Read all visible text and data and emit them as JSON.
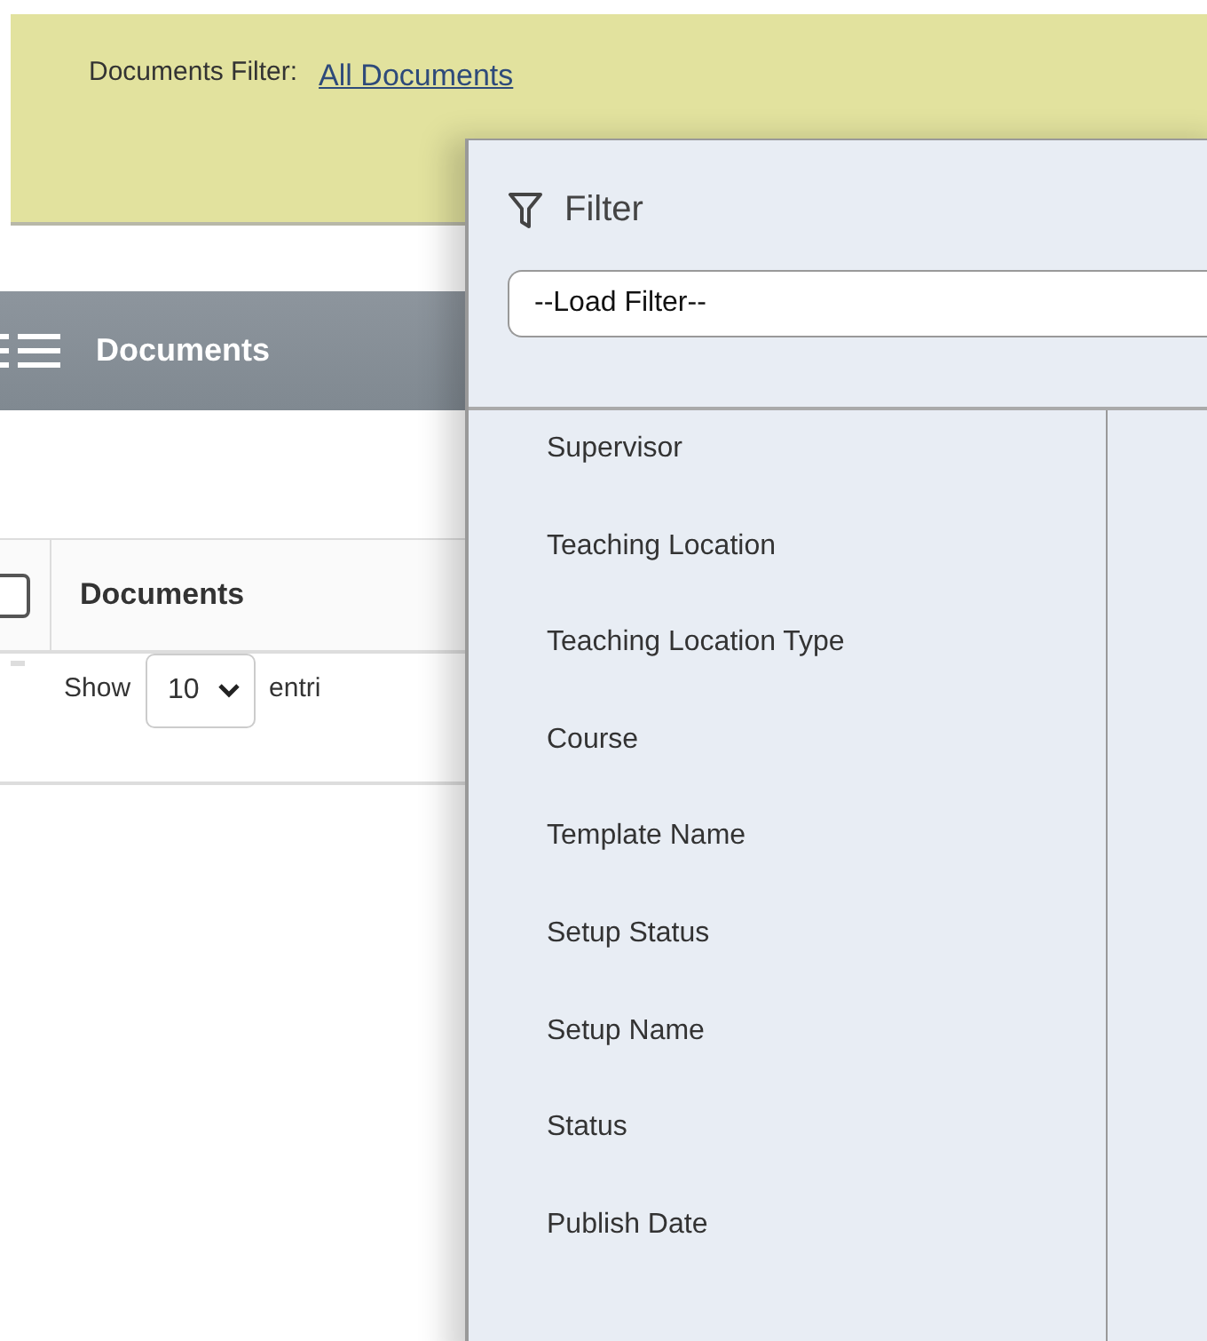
{
  "header": {
    "label": "Documents Filter:",
    "link": "All Documents"
  },
  "documents_bar": {
    "title": "Documents"
  },
  "table": {
    "select_all_checked": false,
    "columns": [
      "Documents"
    ],
    "length_label": "Show",
    "length_value": "10",
    "entries_label": "entri"
  },
  "filter_panel": {
    "title": "Filter",
    "load_filter": "--Load Filter--",
    "items": [
      "Supervisor",
      "Teaching Location",
      "Teaching Location Type",
      "Course",
      "Template Name",
      "Setup Status",
      "Setup Name",
      "Status",
      "Publish Date"
    ]
  }
}
